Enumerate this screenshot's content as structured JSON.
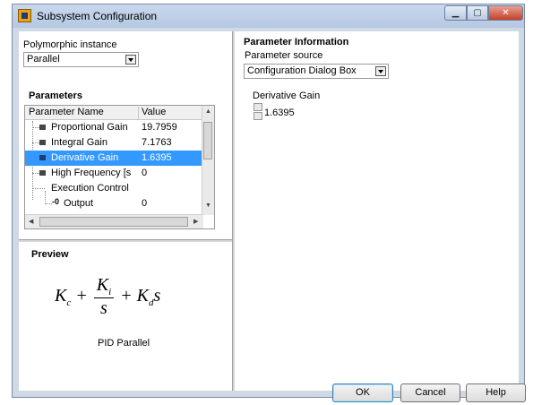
{
  "window": {
    "title": "Subsystem Configuration"
  },
  "left": {
    "instance_label": "Polymorphic instance",
    "instance_value": "Parallel",
    "parameters_heading": "Parameters",
    "columns": [
      "Parameter Name",
      "Value"
    ],
    "rows": [
      {
        "name": "Proportional Gain",
        "value": "19.7959"
      },
      {
        "name": "Integral Gain",
        "value": "7.1763"
      },
      {
        "name": "Derivative Gain",
        "value": "1.6395"
      },
      {
        "name": "High Frequency [s",
        "value": "0"
      },
      {
        "name": "Execution Control",
        "value": ""
      },
      {
        "name": "Output",
        "value": "0"
      }
    ],
    "preview_heading": "Preview",
    "preview_caption": "PID Parallel",
    "formula": {
      "k": "K",
      "c": "c",
      "i": "i",
      "d": "d",
      "s": "s",
      "plus": "+"
    }
  },
  "right": {
    "section_heading": "Parameter Information",
    "source_label": "Parameter source",
    "source_value": "Configuration Dialog Box",
    "gain_label": "Derivative Gain",
    "gain_value": "1.6395"
  },
  "buttons": {
    "ok": "OK",
    "cancel": "Cancel",
    "help": "Help"
  },
  "colors": {
    "selection": "#3399ff",
    "titlebar": "#c9d8ec",
    "close": "#c2412a"
  }
}
